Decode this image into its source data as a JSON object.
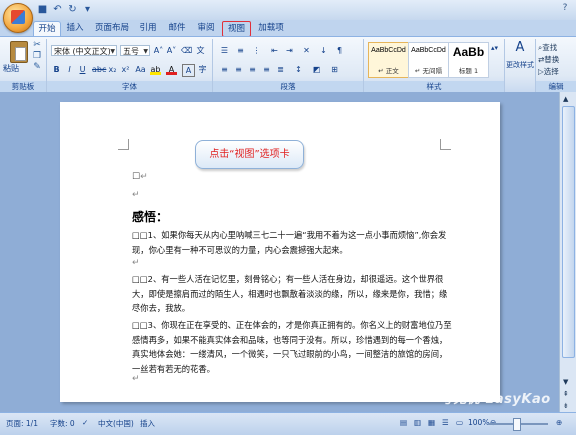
{
  "tabs": [
    "开始",
    "插入",
    "页面布局",
    "引用",
    "邮件",
    "审阅",
    "视图",
    "加载项"
  ],
  "clipboard": {
    "paste_label": "粘贴",
    "group": "剪贴板"
  },
  "font": {
    "font_name": "宋体 (中文正文)",
    "font_size": "五号",
    "group": "字体"
  },
  "paragraph": {
    "group": "段落"
  },
  "styles": {
    "group": "样式",
    "items": [
      {
        "sample": "AaBbCcDd",
        "name": "↵ 正文"
      },
      {
        "sample": "AaBbCcDd",
        "name": "↵ 无间隔"
      },
      {
        "sample": "AaBb",
        "name": "标题 1"
      }
    ],
    "change_label": "更改样式"
  },
  "editing": {
    "find": "查找",
    "replace": "替换",
    "select": "选择",
    "group": "编辑"
  },
  "callout": "点击“视图”选项卡",
  "document": {
    "heading": "感悟：",
    "p1": "□□1、如果你每天从内心里呐喊三七二十一遍“我用不着为这一点小事而烦恼”,你会发现，你心里有一种不可思议的力量，内心会震撼强大起来。",
    "p2": "□□2、有一些人活在记忆里，刻骨铭心；有一些人活在身边，却很遥远。这个世界很大，即使是擦肩而过的陌生人，相遇时也飘散着淡淡的缘，所以，缘来是你，我惜；缘尽你去，我放。",
    "p3": "□□3、你现在正在享受的、正在体会的，才是你真正拥有的。你名义上的财富地位乃至感情再多，如果不能真实体会和品味，也等同于没有。所以，珍惜遇到的每一个香烛，真实地体会她：一缕清风，一个微笑，一只飞过眼前的小鸟，一间整洁的旅馆的房间，一丝若有若无的花香。"
  },
  "status": {
    "page": "页面: 1/1",
    "words": "字数: 0",
    "language": "中文(中国)",
    "mode": "插入",
    "zoom": "100%"
  },
  "watermark": "考无忧 EasyKao"
}
